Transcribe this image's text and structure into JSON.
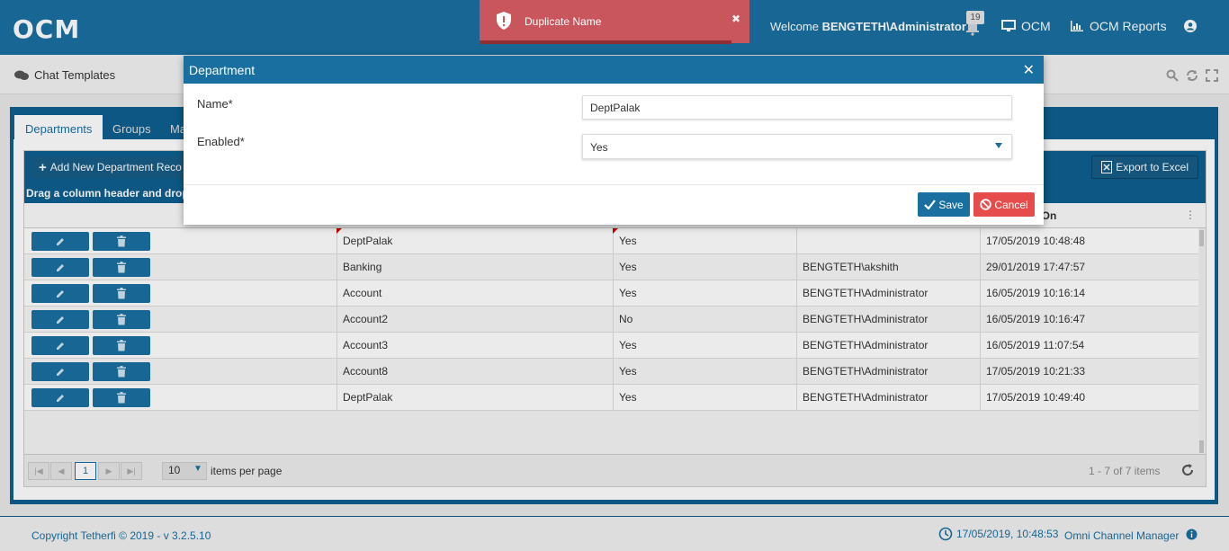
{
  "app": {
    "logo": "OCM",
    "welcome_prefix": "Welcome ",
    "welcome_user": "BENGTETH\\Administrator",
    "notification_count": "19",
    "nav_ocm": "OCM",
    "nav_reports": "OCM Reports"
  },
  "toast": {
    "message": "Duplicate Name",
    "close": "✖"
  },
  "subheader": {
    "title": "Chat Templates"
  },
  "tabs": [
    {
      "label": "Departments"
    },
    {
      "label": "Groups"
    },
    {
      "label": "Ma"
    }
  ],
  "grid": {
    "add_button": "Add New Department Reco",
    "export_button": "Export to Excel",
    "group_hint": "Drag a column header and drop",
    "changed_on_header": "ged On",
    "rows": [
      {
        "name": "DeptPalak",
        "enabled": "Yes",
        "changed_by": "",
        "changed_on": "17/05/2019 10:48:48"
      },
      {
        "name": "Banking",
        "enabled": "Yes",
        "changed_by": "BENGTETH\\akshith",
        "changed_on": "29/01/2019 17:47:57"
      },
      {
        "name": "Account",
        "enabled": "Yes",
        "changed_by": "BENGTETH\\Administrator",
        "changed_on": "16/05/2019 10:16:14"
      },
      {
        "name": "Account2",
        "enabled": "No",
        "changed_by": "BENGTETH\\Administrator",
        "changed_on": "16/05/2019 10:16:47"
      },
      {
        "name": "Account3",
        "enabled": "Yes",
        "changed_by": "BENGTETH\\Administrator",
        "changed_on": "16/05/2019 11:07:54"
      },
      {
        "name": "Account8",
        "enabled": "Yes",
        "changed_by": "BENGTETH\\Administrator",
        "changed_on": "17/05/2019 10:21:33"
      },
      {
        "name": "DeptPalak",
        "enabled": "Yes",
        "changed_by": "BENGTETH\\Administrator",
        "changed_on": "17/05/2019 10:49:40"
      }
    ],
    "pager": {
      "current_page": "1",
      "page_size": "10",
      "items_per_page_label": "items per page",
      "info": "1 - 7 of 7 items"
    }
  },
  "footer": {
    "copyright": "Copyright Tetherfi © 2019 - v 3.2.5.10",
    "datetime": "17/05/2019, 10:48:53",
    "app_name": "Omni Channel Manager"
  },
  "modal": {
    "title": "Department",
    "close": "✕",
    "name_label": "Name*",
    "name_value": "DeptPalak",
    "enabled_label": "Enabled*",
    "enabled_value": "Yes",
    "save_label": "Save",
    "cancel_label": "Cancel"
  },
  "colors": {
    "primary": "#1a6fa1",
    "dark": "#0e5f90",
    "toast": "#c9565c",
    "cancel": "#e74c4c"
  }
}
